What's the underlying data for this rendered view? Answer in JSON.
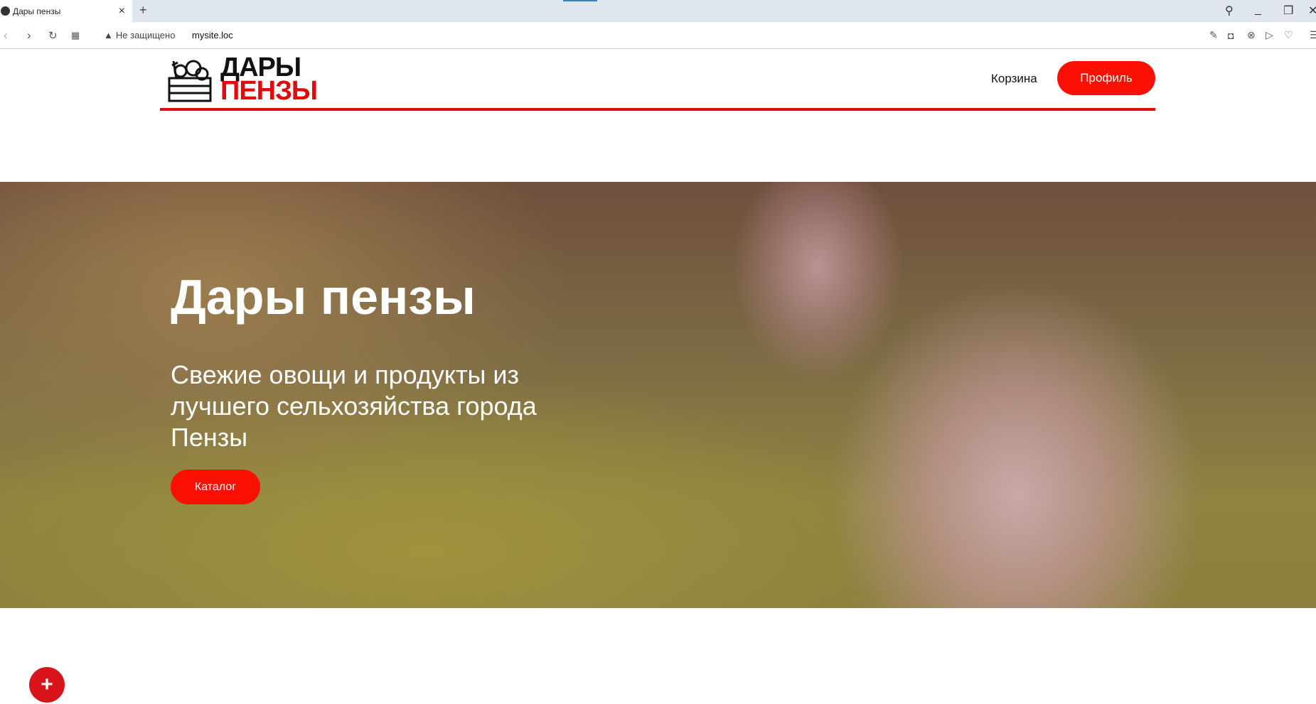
{
  "browser": {
    "tab_title": "Дары пензы",
    "new_tab": "+",
    "close": "×",
    "security": "Не защищено",
    "url": "mysite.loc",
    "icons": [
      "back-icon",
      "forward-icon",
      "reload-icon",
      "apps-icon",
      "warning-icon",
      "edit-icon",
      "camera-icon",
      "shield-icon",
      "send-icon",
      "heart-icon",
      "search-icon",
      "minimize-icon",
      "restore-icon",
      "close-icon"
    ]
  },
  "header": {
    "logo_line1": "ДАРЫ",
    "logo_line2": "ПЕНЗЫ",
    "cart": "Корзина",
    "profile": "Профиль"
  },
  "hero": {
    "title": "Дары пензы",
    "subtitle": "Свежие овощи и продукты из лучшего сельхозяйства города Пензы",
    "button": "Каталог"
  },
  "fab": "+",
  "colors": {
    "accent": "#fb1003",
    "line": "#e3090a"
  }
}
